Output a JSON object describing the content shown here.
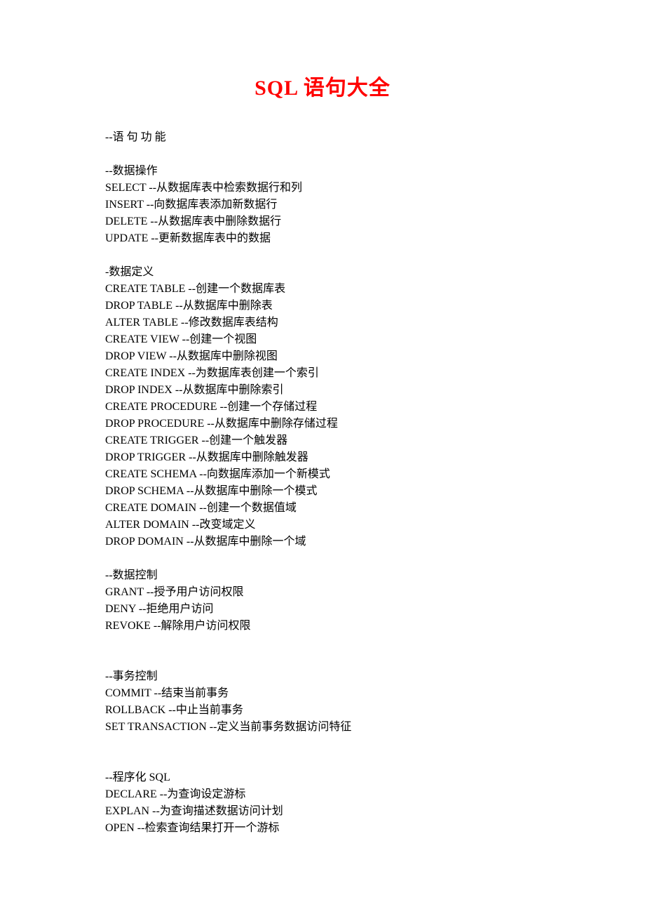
{
  "title": "SQL 语句大全",
  "sections": [
    {
      "lines": [
        "--语 句 功 能"
      ]
    },
    {
      "lines": [
        "--数据操作",
        "SELECT --从数据库表中检索数据行和列",
        "INSERT --向数据库表添加新数据行",
        "DELETE --从数据库表中删除数据行",
        "UPDATE --更新数据库表中的数据"
      ]
    },
    {
      "lines": [
        "-数据定义",
        "CREATE TABLE --创建一个数据库表",
        "DROP TABLE --从数据库中删除表",
        "ALTER TABLE --修改数据库表结构",
        "CREATE VIEW --创建一个视图",
        "DROP VIEW --从数据库中删除视图",
        "CREATE INDEX --为数据库表创建一个索引",
        "DROP INDEX --从数据库中删除索引",
        "CREATE PROCEDURE --创建一个存储过程",
        "DROP PROCEDURE --从数据库中删除存储过程",
        "CREATE TRIGGER --创建一个触发器",
        "DROP TRIGGER --从数据库中删除触发器",
        "CREATE SCHEMA --向数据库添加一个新模式",
        "DROP SCHEMA --从数据库中删除一个模式",
        "CREATE DOMAIN --创建一个数据值域",
        "ALTER DOMAIN --改变域定义",
        "DROP DOMAIN --从数据库中删除一个域"
      ]
    },
    {
      "lines": [
        "--数据控制",
        "GRANT --授予用户访问权限",
        "DENY --拒绝用户访问",
        "REVOKE --解除用户访问权限"
      ]
    },
    {
      "lines": [
        "",
        "--事务控制",
        "COMMIT --结束当前事务",
        "ROLLBACK --中止当前事务",
        "SET TRANSACTION --定义当前事务数据访问特征"
      ]
    },
    {
      "lines": [
        "",
        "--程序化 SQL",
        "DECLARE --为查询设定游标",
        "EXPLAN --为查询描述数据访问计划",
        "OPEN --检索查询结果打开一个游标"
      ]
    }
  ]
}
